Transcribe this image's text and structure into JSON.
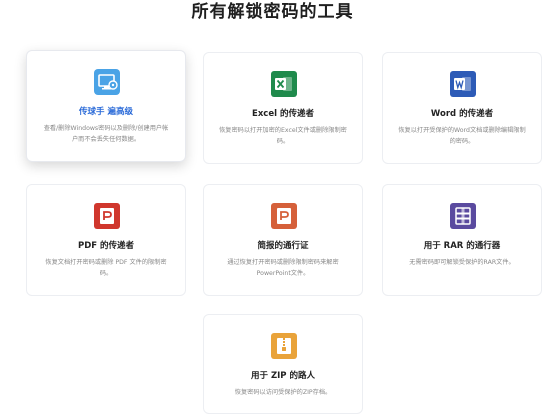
{
  "page": {
    "title": "所有解锁密码的工具"
  },
  "cards": [
    {
      "title": "传球手 遍高级",
      "desc": "查看/删除Windows密码以及删除/创建用户帐户而不会丢失任何数据。",
      "icon": "computer-gear-icon",
      "color": "#4aa3e6"
    },
    {
      "title": "Excel 的传递者",
      "desc": "恢复密码以打开加密的Excel文件或删除限制密码。",
      "icon": "excel-icon",
      "color": "#1f8a4c"
    },
    {
      "title": "Word 的传递者",
      "desc": "恢复以打开受保护的Word文档或删除编辑限制的密码。",
      "icon": "word-icon",
      "color": "#2d5bb7"
    },
    {
      "title": "PDF 的传递者",
      "desc": "恢复文档打开密码或删除 PDF 文件的限制密码。",
      "icon": "pdf-icon",
      "color": "#d0372d"
    },
    {
      "title": "简报的通行证",
      "desc": "通过恢复打开密码或删除限制密码来解密PowerPoint文件。",
      "icon": "powerpoint-icon",
      "color": "#d5603a"
    },
    {
      "title": "用于 RAR 的通行器",
      "desc": "无需密码即可解锁受保护的RAR文件。",
      "icon": "rar-icon",
      "color": "#5a4a9f"
    },
    {
      "title": "用于 ZIP 的路人",
      "desc": "恢复密码以访问受保护的ZIP存档。",
      "icon": "zip-icon",
      "color": "#e9a33a"
    }
  ]
}
